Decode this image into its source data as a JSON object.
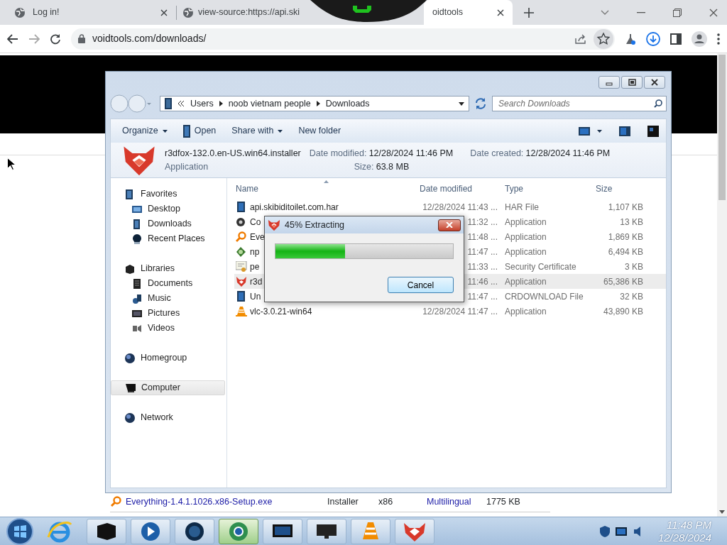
{
  "browser": {
    "tabs": [
      {
        "title": "Log in!",
        "selected": false,
        "closable": true,
        "favicon": true
      },
      {
        "title": "view-source:https://api.ski",
        "selected": false,
        "closable": false,
        "favicon": true
      },
      {
        "title": "oidtools",
        "selected": true,
        "closable": true,
        "favicon": false
      }
    ],
    "address": "voidtools.com/downloads/"
  },
  "page": {
    "downloads": [
      {
        "name": "Everything-1.4.1.1026.x86-Setup.exe",
        "type": "Installer",
        "platform": "x86",
        "language": "Multilingual",
        "size": "1775 KB"
      }
    ]
  },
  "explorer": {
    "breadcrumb": [
      "Users",
      "noob vietnam people",
      "Downloads"
    ],
    "search_placeholder": "Search Downloads",
    "toolbar": [
      {
        "label": "Organize",
        "dropdown": true,
        "kind": "menu"
      },
      {
        "label": "Open",
        "dropdown": false,
        "kind": "open"
      },
      {
        "label": "Share with",
        "dropdown": true,
        "kind": "menu"
      },
      {
        "label": "New folder",
        "dropdown": false,
        "kind": "menu"
      }
    ],
    "details": {
      "name": "r3dfox-132.0.en-US.win64.installer",
      "type": "Application",
      "modified_label": "Date modified:",
      "modified": "12/28/2024 11:46 PM",
      "size_label": "Size:",
      "size": "63.8 MB",
      "created_label": "Date created:",
      "created": "12/28/2024 11:46 PM"
    },
    "sidebar": [
      {
        "label": "Favorites",
        "kind": "star",
        "selected": false,
        "children": [
          {
            "label": "Desktop",
            "kind": "desktop",
            "selected": false
          },
          {
            "label": "Downloads",
            "kind": "downloads",
            "selected": false
          },
          {
            "label": "Recent Places",
            "kind": "recent",
            "selected": false
          }
        ]
      },
      {
        "label": "Libraries",
        "kind": "library",
        "selected": false,
        "children": [
          {
            "label": "Documents",
            "kind": "documents",
            "selected": false
          },
          {
            "label": "Music",
            "kind": "music",
            "selected": false
          },
          {
            "label": "Pictures",
            "kind": "pictures",
            "selected": false
          },
          {
            "label": "Videos",
            "kind": "videos",
            "selected": false
          }
        ]
      },
      {
        "label": "Homegroup",
        "kind": "globe",
        "selected": false
      },
      {
        "label": "Computer",
        "kind": "computer",
        "selected": true
      },
      {
        "label": "Network",
        "kind": "globe",
        "selected": false
      }
    ],
    "columns": [
      "Name",
      "Date modified",
      "Type",
      "Size"
    ],
    "files": [
      {
        "name": "api.skibiditoilet.com.har",
        "date": "12/28/2024 11:43 ...",
        "type": "HAR File",
        "size": "1,107 KB",
        "kind": "doc",
        "selected": false
      },
      {
        "name": "Co",
        "date": "11:32 ...",
        "type": "Application",
        "size": "13 KB",
        "kind": "gear",
        "selected": false
      },
      {
        "name": "Eve",
        "date": "11:48 ...",
        "type": "Application",
        "size": "1,869 KB",
        "kind": "search",
        "selected": false
      },
      {
        "name": "np",
        "date": "11:47 ...",
        "type": "Application",
        "size": "6,494 KB",
        "kind": "green",
        "selected": false
      },
      {
        "name": "pe",
        "date": "11:33 ...",
        "type": "Security Certificate",
        "size": "3 KB",
        "kind": "cert",
        "selected": false
      },
      {
        "name": "r3d",
        "date": "11:46 ...",
        "type": "Application",
        "size": "65,386 KB",
        "kind": "fox",
        "selected": true
      },
      {
        "name": "Un",
        "date": "11:47 ...",
        "type": "CRDOWNLOAD File",
        "size": "32 KB",
        "kind": "doc",
        "selected": false
      },
      {
        "name": "vlc-3.0.21-win64",
        "date": "12/28/2024 11:47 ...",
        "type": "Application",
        "size": "43,890 KB",
        "kind": "cone",
        "selected": false
      }
    ]
  },
  "dialog": {
    "title": "45% Extracting",
    "level": 0.39,
    "button": "Cancel"
  },
  "taskbar": {
    "items": [
      {
        "kind": "box",
        "selected": false
      },
      {
        "kind": "media",
        "selected": false
      },
      {
        "kind": "globe",
        "selected": false
      },
      {
        "kind": "chrome",
        "selected": true
      },
      {
        "kind": "monitor",
        "selected": false
      },
      {
        "kind": "display",
        "selected": false
      },
      {
        "kind": "cone",
        "selected": false
      },
      {
        "kind": "fox",
        "selected": false
      }
    ],
    "time": "11:48 PM",
    "date": "12/28/2024"
  }
}
